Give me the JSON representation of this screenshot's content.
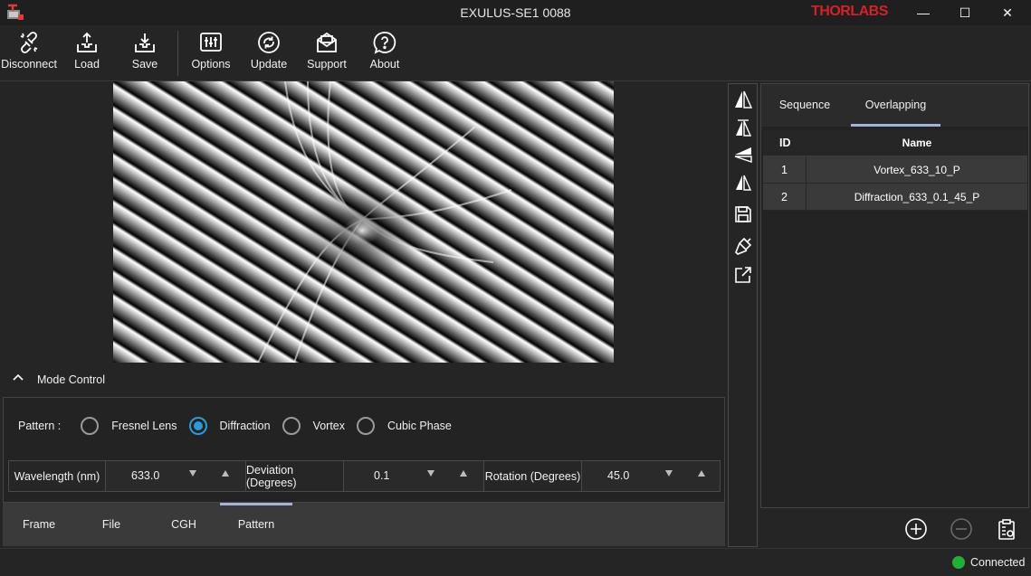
{
  "window": {
    "title": "EXULUS-SE1 0088",
    "brand": "THORLABS",
    "controls": {
      "minimize": "—",
      "maximize": "☐",
      "close": "✕"
    }
  },
  "toolbar": {
    "disconnect": "Disconnect",
    "load": "Load",
    "save": "Save",
    "options": "Options",
    "update": "Update",
    "support": "Support",
    "about": "About"
  },
  "mode_control": {
    "title": "Mode Control",
    "pattern_label": "Pattern :",
    "patterns": [
      "Fresnel Lens",
      "Diffraction",
      "Vortex",
      "Cubic Phase"
    ],
    "selected_pattern": "Diffraction"
  },
  "parameters": {
    "wavelength": {
      "label": "Wavelength (nm)",
      "value": "633.0"
    },
    "deviation": {
      "label": "Deviation (Degrees)",
      "value": "0.1"
    },
    "rotation": {
      "label": "Rotation (Degrees)",
      "value": "45.0"
    }
  },
  "bottom_tabs": {
    "items": [
      "Frame",
      "File",
      "CGH",
      "Pattern"
    ],
    "active": "Pattern"
  },
  "side_tools": [
    "flip-horizontal-icon",
    "flip-vertical-icon",
    "triangle-icon",
    "mirror-icon",
    "save-icon",
    "brush-icon",
    "export-icon"
  ],
  "right_panel": {
    "tabs": [
      "Sequence",
      "Overlapping"
    ],
    "active_tab": "Overlapping",
    "columns": {
      "id": "ID",
      "name": "Name"
    },
    "rows": [
      {
        "id": "1",
        "name": "Vortex_633_10_P"
      },
      {
        "id": "2",
        "name": "Diffraction_633_0.1_45_P"
      }
    ]
  },
  "status": {
    "text": "Connected",
    "color": "#1fb036"
  },
  "colors": {
    "accent": "#2a9bd6",
    "brand": "#d4202a",
    "tab_indicator": "#a6b1d8"
  }
}
